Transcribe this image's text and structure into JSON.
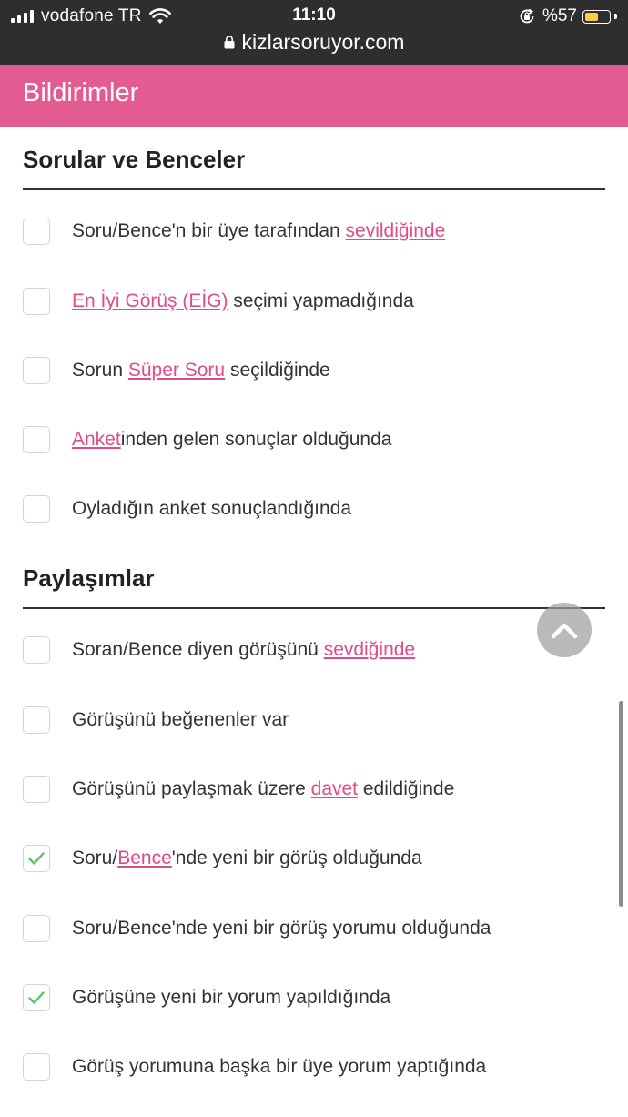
{
  "status_bar": {
    "carrier": "vodafone TR",
    "time": "11:10",
    "battery_percent": "%57",
    "battery_level": 0.57,
    "url": "kizlarsoruyor.com"
  },
  "header": {
    "title": "Bildirimler"
  },
  "colors": {
    "accent": "#e25b91",
    "link": "#e04b88",
    "check": "#5ac466",
    "status_bar": "#2e2e2e"
  },
  "sections": [
    {
      "title": "Sorular ve Benceler",
      "items": [
        {
          "before": "Soru/Bence'n bir üye tarafından ",
          "link": "sevildiğinde",
          "after": "",
          "checked": false
        },
        {
          "before": "",
          "link": "En İyi Görüş (EİG)",
          "after": " seçimi yapmadığında",
          "checked": false
        },
        {
          "before": "Sorun ",
          "link": "Süper Soru",
          "after": " seçildiğinde",
          "checked": false
        },
        {
          "before": "",
          "link": "Anket",
          "after": "inden gelen sonuçlar olduğunda",
          "checked": false
        },
        {
          "before": "Oyladığın anket sonuçlandığında",
          "link": "",
          "after": "",
          "checked": false
        }
      ]
    },
    {
      "title": "Paylaşımlar",
      "items": [
        {
          "before": "Soran/Bence diyen görüşünü ",
          "link": "sevdiğinde",
          "after": "",
          "checked": false
        },
        {
          "before": "Görüşünü beğenenler var",
          "link": "",
          "after": "",
          "checked": false
        },
        {
          "before": "Görüşünü paylaşmak üzere ",
          "link": "davet",
          "after": " edildiğinde",
          "checked": false
        },
        {
          "before": "Soru/",
          "link": "Bence",
          "after": "'nde yeni bir görüş olduğunda",
          "checked": true
        },
        {
          "before": "Soru/Bence'nde yeni bir görüş yorumu olduğunda",
          "link": "",
          "after": "",
          "checked": false
        },
        {
          "before": "Görüşüne yeni bir yorum yapıldığında",
          "link": "",
          "after": "",
          "checked": true
        },
        {
          "before": "Görüş yorumuna başka bir üye yorum yaptığında",
          "link": "",
          "after": "",
          "checked": false
        }
      ]
    }
  ]
}
